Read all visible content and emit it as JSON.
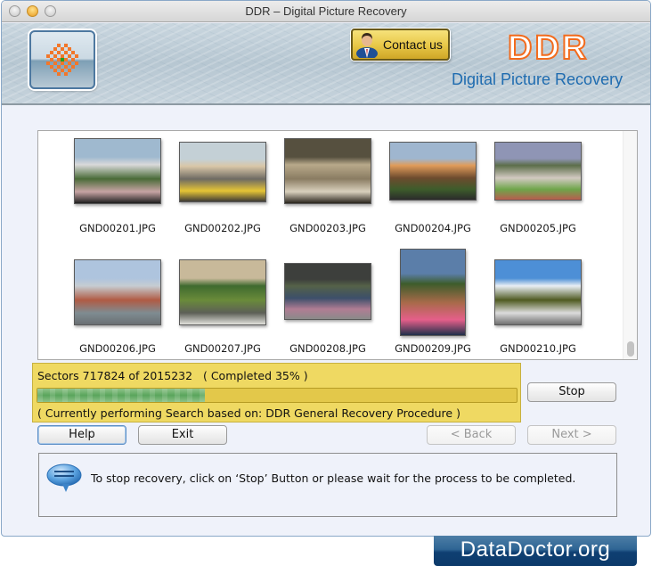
{
  "window": {
    "title": "DDR – Digital Picture Recovery"
  },
  "header": {
    "logo_icon": "ddr-checker-logo-icon",
    "contact_button_label": "Contact us",
    "contact_icon": "businessman-icon",
    "brand_short": "DDR",
    "product_name": "Digital Picture Recovery"
  },
  "gallery": {
    "items": [
      {
        "filename": "GND00201.JPG",
        "colors": [
          "#9fb9cf",
          "#d9d9d9",
          "#4a6b38",
          "#c7a4a4",
          "#1f1f1f"
        ]
      },
      {
        "filename": "GND00202.JPG",
        "colors": [
          "#c4d0d6",
          "#d9c7a8",
          "#6e6a63",
          "#e6c535",
          "#3e3a36"
        ]
      },
      {
        "filename": "GND00203.JPG",
        "colors": [
          "#56503f",
          "#b8a98a",
          "#8a7c62",
          "#d9d0bd",
          "#2a251d"
        ]
      },
      {
        "filename": "GND00204.JPG",
        "colors": [
          "#9fb6cf",
          "#e09c5a",
          "#6d4b2e",
          "#3d5c2b",
          "#2b2b2b"
        ]
      },
      {
        "filename": "GND00205.JPG",
        "colors": [
          "#8f95b5",
          "#5c6e4a",
          "#d2c9c1",
          "#6ea54a",
          "#b85d4f"
        ]
      },
      {
        "filename": "GND00206.JPG",
        "colors": [
          "#aec4de",
          "#c6ccd1",
          "#b05b44",
          "#7f8c91",
          "#6a6f73"
        ]
      },
      {
        "filename": "GND00207.JPG",
        "colors": [
          "#c8b99a",
          "#3f6a2f",
          "#6a8b3a",
          "#5d5f57",
          "#e1e1dc"
        ]
      },
      {
        "filename": "GND00208.JPG",
        "colors": [
          "#3d3f3c",
          "#556248",
          "#3c4f6a",
          "#b07d94",
          "#8a8a8a"
        ]
      },
      {
        "filename": "GND00209.JPG",
        "colors": [
          "#5b7ea9",
          "#3d5c2b",
          "#a86a4a",
          "#e55f8a",
          "#1f2f4a"
        ]
      },
      {
        "filename": "GND00210.JPG",
        "colors": [
          "#4d8fd6",
          "#e9eef4",
          "#4f5a21",
          "#dcdcdc",
          "#6f6f6f"
        ]
      }
    ]
  },
  "progress": {
    "sectors_text": "Sectors 717824 of 2015232   ( Completed 35% )",
    "sectors_done": 717824,
    "sectors_total": 2015232,
    "percent_complete": 35,
    "status_text": "( Currently performing Search based on: DDR General Recovery Procedure )",
    "colors": {
      "box": "#efd962",
      "fill": "#5aa55c"
    }
  },
  "buttons": {
    "stop": "Stop",
    "help": "Help",
    "exit": "Exit",
    "back": "< Back",
    "next": "Next >"
  },
  "info": {
    "icon": "speech-bubble-icon",
    "message": "To stop recovery, click on ‘Stop’ Button or please wait for the process to be completed."
  },
  "footer": {
    "brand": "DataDoctor.org"
  }
}
